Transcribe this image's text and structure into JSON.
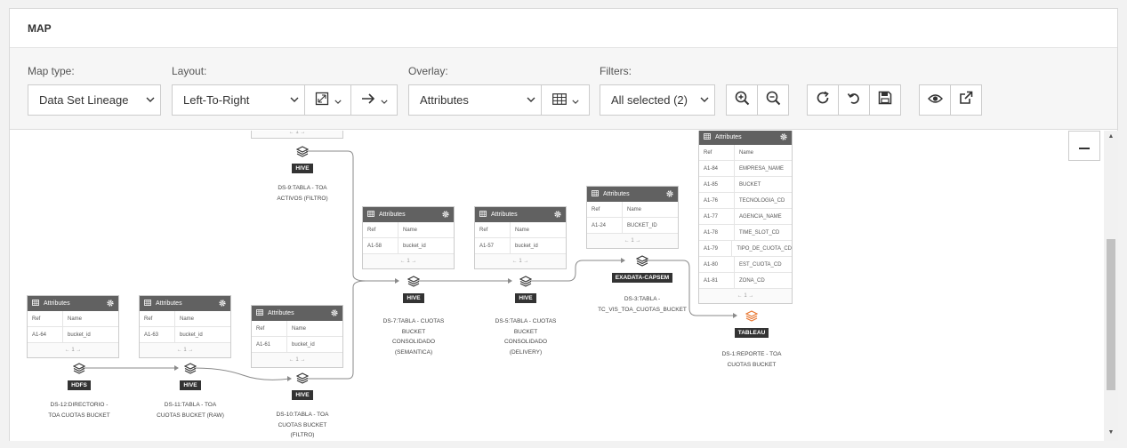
{
  "panel": {
    "title": "MAP"
  },
  "toolbar": {
    "map_type_label": "Map type:",
    "map_type_value": "Data Set Lineage",
    "layout_label": "Layout:",
    "layout_value": "Left-To-Right",
    "overlay_label": "Overlay:",
    "overlay_value": "Attributes",
    "filters_label": "Filters:",
    "filters_value": "All selected (2)",
    "icons": [
      "fit-icon",
      "arrow-right-icon",
      "table-icon",
      "zoom-in-icon",
      "zoom-out-icon",
      "refresh-icon",
      "undo-icon",
      "save-icon",
      "eye-icon",
      "external-link-icon"
    ]
  },
  "card_common": {
    "title": "Attributes",
    "col_ref": "Ref",
    "col_name": "Name",
    "pager": "← 1 →"
  },
  "cards": [
    {
      "id": "ds12",
      "rows": [
        {
          "ref": "A1-64",
          "name": "bucket_id"
        }
      ]
    },
    {
      "id": "ds11",
      "rows": [
        {
          "ref": "A1-63",
          "name": "bucket_id"
        }
      ]
    },
    {
      "id": "ds10",
      "rows": [
        {
          "ref": "A1-61",
          "name": "bucket_id"
        }
      ]
    },
    {
      "id": "ds7",
      "rows": [
        {
          "ref": "A1-58",
          "name": "bucket_id"
        }
      ]
    },
    {
      "id": "ds5",
      "rows": [
        {
          "ref": "A1-57",
          "name": "bucket_id"
        }
      ]
    },
    {
      "id": "ds3",
      "rows": [
        {
          "ref": "A1-24",
          "name": "BUCKET_ID"
        }
      ]
    },
    {
      "id": "ds1",
      "rows": [
        {
          "ref": "A1-84",
          "name": "EMPRESA_NAME"
        },
        {
          "ref": "A1-85",
          "name": "BUCKET"
        },
        {
          "ref": "A1-76",
          "name": "TECNOLOGIA_CD"
        },
        {
          "ref": "A1-77",
          "name": "AGENCIA_NAME"
        },
        {
          "ref": "A1-78",
          "name": "TIME_SLOT_CD"
        },
        {
          "ref": "A1-79",
          "name": "TIPO_DE_CUOTA_CD"
        },
        {
          "ref": "A1-80",
          "name": "EST_CUOTA_CD"
        },
        {
          "ref": "A1-81",
          "name": "ZONA_CD"
        }
      ]
    }
  ],
  "nodes": [
    {
      "id": "ds12",
      "badge": "HDFS",
      "label_lines": [
        "DS-12:DIRECTORIO -",
        "TOA CUOTAS BUCKET"
      ]
    },
    {
      "id": "ds11",
      "badge": "HIVE",
      "label_lines": [
        "DS-11:TABLA - TOA",
        "CUOTAS BUCKET (RAW)"
      ]
    },
    {
      "id": "ds10",
      "badge": "HIVE",
      "label_lines": [
        "DS-10:TABLA - TOA",
        "CUOTAS BUCKET",
        "(FILTRO)"
      ]
    },
    {
      "id": "ds9",
      "badge": "HIVE",
      "label_lines": [
        "DS-9:TABLA - TOA",
        "ACTIVOS (FILTRO)"
      ]
    },
    {
      "id": "ds7",
      "badge": "HIVE",
      "label_lines": [
        "DS-7:TABLA - CUOTAS",
        "BUCKET",
        "CONSOLIDADO",
        "(SEMANTICA)"
      ]
    },
    {
      "id": "ds5",
      "badge": "HIVE",
      "label_lines": [
        "DS-5:TABLA - CUOTAS",
        "BUCKET",
        "CONSOLIDADO",
        "(DELIVERY)"
      ]
    },
    {
      "id": "ds3",
      "badge": "EXADATA-CAPSEM",
      "label_lines": [
        "DS-3:TABLA -",
        "TC_VIS_TOA_CUOTAS_BUCKET"
      ]
    },
    {
      "id": "ds1",
      "badge": "TABLEAU",
      "label_lines": [
        "DS-1:REPORTE - TOA",
        "CUOTAS BUCKET"
      ]
    }
  ],
  "colors": {
    "card_header": "#616161",
    "badge": "#333333",
    "tableau_icon": "#e8742c",
    "edge": "#888888"
  },
  "top_card_pager": "← 1 →"
}
